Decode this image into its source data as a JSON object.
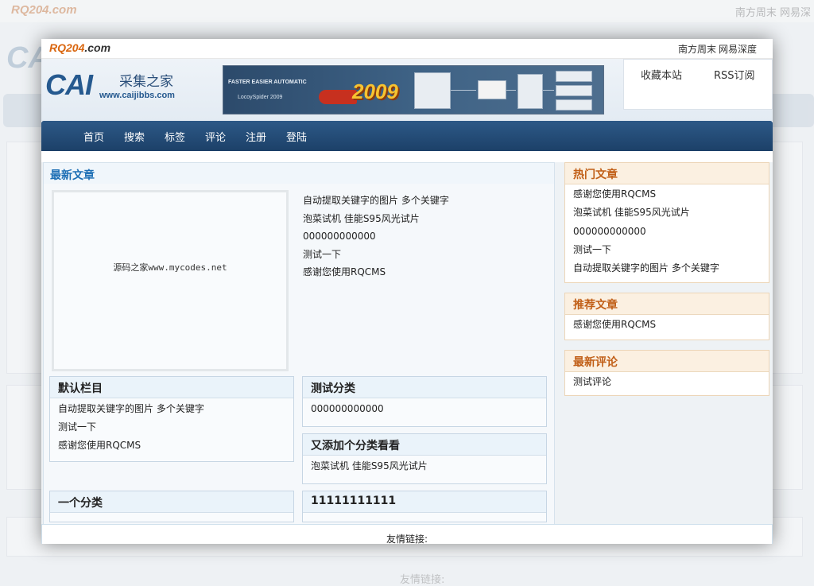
{
  "background": {
    "site_logo": "RQ204.com",
    "top_links": "南方周末 网易深",
    "cai": "CAI",
    "friend_links": "友情链接:"
  },
  "window": {
    "site_logo": {
      "main": "RQ204",
      "suffix": ".com"
    },
    "top_links": [
      "南方周末",
      "网易深度"
    ],
    "header": {
      "logo_cai": "CAI",
      "logo_cn": "采集之家",
      "logo_url": "www.caijibbs.com",
      "banner": {
        "line1": "FASTER  EASIER  AUTOMATIC",
        "line2": "LocoySpider 2009",
        "year": "2009"
      },
      "favorites": {
        "bookmark": "收藏本站",
        "rss": "RSS订阅"
      }
    },
    "nav": [
      "首页",
      "搜索",
      "标签",
      "评论",
      "注册",
      "登陆"
    ],
    "latest": {
      "title": "最新文章",
      "image_caption": "源码之家www.mycodes.net",
      "items": [
        "自动提取关键字的图片 多个关键字",
        "泡菜试机 佳能S95风光试片",
        "000000000000",
        "测试一下",
        "感谢您使用RQCMS"
      ]
    },
    "categories": [
      {
        "title": "默认栏目",
        "items": [
          "自动提取关键字的图片 多个关键字",
          "测试一下",
          "感谢您使用RQCMS"
        ]
      },
      {
        "title": "测试分类",
        "items": [
          "000000000000"
        ]
      },
      {
        "title": "又添加个分类看看",
        "items": [
          "泡菜试机 佳能S95风光试片"
        ]
      },
      {
        "title": "一个分类",
        "items": []
      },
      {
        "title": "11111111111",
        "items": []
      }
    ],
    "sidebar": {
      "hot": {
        "title": "热门文章",
        "items": [
          "感谢您使用RQCMS",
          "泡菜试机 佳能S95风光试片",
          "000000000000",
          "测试一下",
          "自动提取关键字的图片 多个关键字"
        ]
      },
      "recommended": {
        "title": "推荐文章",
        "items": [
          "感谢您使用RQCMS"
        ]
      },
      "comments": {
        "title": "最新评论",
        "items": [
          "测试评论"
        ]
      }
    },
    "friend_links": "友情链接:"
  },
  "colors": {
    "nav": "#1f4670",
    "accent_orange": "#c15f17",
    "logo_blue": "#25598f"
  }
}
